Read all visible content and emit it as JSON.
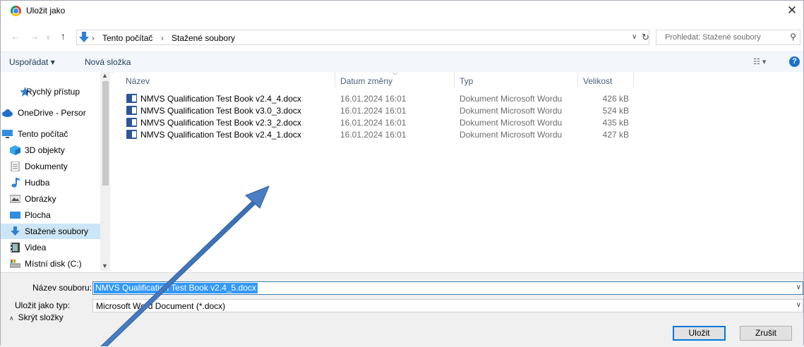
{
  "window": {
    "title": "Uložit jako",
    "close_glyph": "✕"
  },
  "address": {
    "crumbs": [
      "Tento počítač",
      "Stažené soubory"
    ],
    "search_placeholder": "Prohledat: Stažené soubory"
  },
  "toolbar": {
    "organize": "Uspořádat ▾",
    "new_folder": "Nová složka",
    "view_glyph": "☷ ▾",
    "help_glyph": "?"
  },
  "nav": {
    "items": [
      {
        "label": "Rychlý přístup",
        "icon": "star-icon"
      },
      {
        "label": "OneDrive - Persor",
        "icon": "cloud-icon"
      },
      {
        "label": "Tento počítač",
        "icon": "computer-icon"
      },
      {
        "label": "3D objekty",
        "icon": "cube-icon"
      },
      {
        "label": "Dokumenty",
        "icon": "document-icon"
      },
      {
        "label": "Hudba",
        "icon": "music-icon"
      },
      {
        "label": "Obrázky",
        "icon": "picture-icon"
      },
      {
        "label": "Plocha",
        "icon": "desktop-icon"
      },
      {
        "label": "Stažené soubory",
        "icon": "download-icon",
        "selected": true
      },
      {
        "label": "Videa",
        "icon": "video-icon"
      },
      {
        "label": "Místní disk (C:)",
        "icon": "disk-icon"
      }
    ]
  },
  "files": {
    "columns": {
      "name": "Název",
      "date": "Datum změny",
      "type": "Typ",
      "size": "Velikost"
    },
    "rows": [
      {
        "name": "NMVS Qualification Test Book v2.4_4.docx",
        "date": "16.01.2024 16:01",
        "type": "Dokument Microsoft Wordu",
        "size": "426 kB"
      },
      {
        "name": "NMVS Qualification Test Book v3.0_3.docx",
        "date": "16.01.2024 16:01",
        "type": "Dokument Microsoft Wordu",
        "size": "524 kB"
      },
      {
        "name": "NMVS Qualification Test Book v2.3_2.docx",
        "date": "16.01.2024 16:01",
        "type": "Dokument Microsoft Wordu",
        "size": "435 kB"
      },
      {
        "name": "NMVS Qualification Test Book v2.4_1.docx",
        "date": "16.01.2024 16:01",
        "type": "Dokument Microsoft Wordu",
        "size": "427 kB"
      }
    ]
  },
  "form": {
    "filename_label": "Název souboru:",
    "filename_value": "NMVS Qualification Test Book v2.4_5.docx",
    "type_label": "Uložit jako typ:",
    "type_value": "Microsoft Word Document (*.docx)",
    "hide_folders": "Skrýt složky",
    "save": "Uložit",
    "cancel": "Zrušit"
  },
  "colors": {
    "selection": "#3399ff",
    "nav_selected": "#cde6f7",
    "annotation_arrow": "#4a7ec2"
  }
}
